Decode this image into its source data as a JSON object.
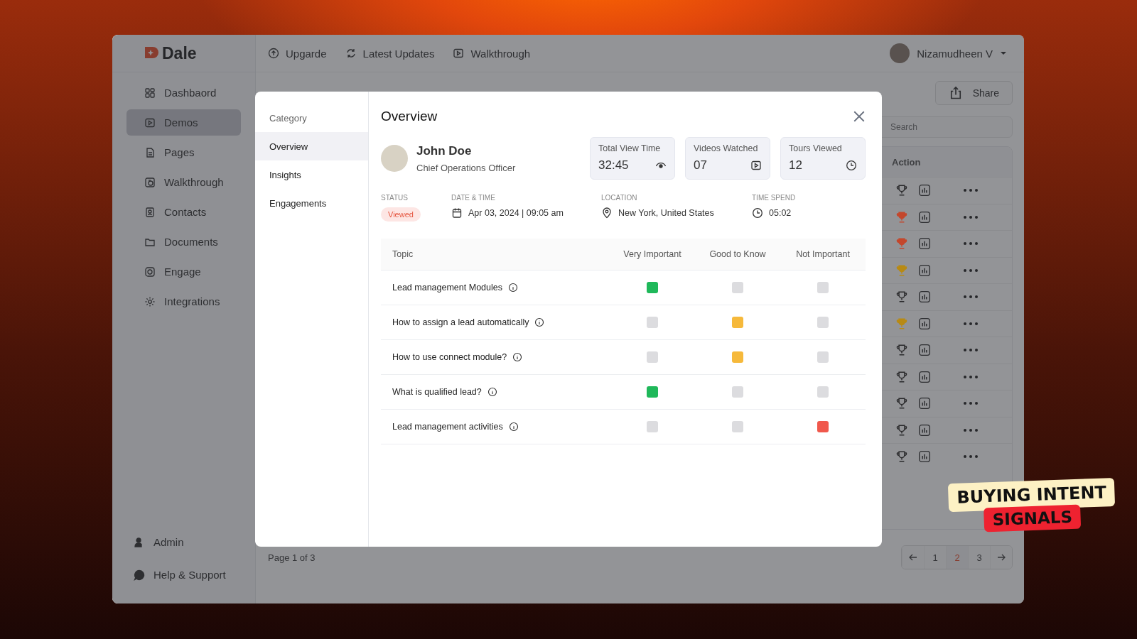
{
  "brand": "Dale",
  "topnav": [
    {
      "label": "Upgarde"
    },
    {
      "label": "Latest Updates"
    },
    {
      "label": "Walkthrough"
    }
  ],
  "user": {
    "name": "Nizamudheen V"
  },
  "sidebar": {
    "items": [
      {
        "label": "Dashbaord",
        "selected": false
      },
      {
        "label": "Demos",
        "selected": true
      },
      {
        "label": "Pages",
        "selected": false
      },
      {
        "label": "Walkthrough",
        "selected": false
      },
      {
        "label": "Contacts",
        "selected": false
      },
      {
        "label": "Documents",
        "selected": false
      },
      {
        "label": "Engage",
        "selected": false
      },
      {
        "label": "Integrations",
        "selected": false
      }
    ],
    "footer": [
      {
        "label": "Admin"
      },
      {
        "label": "Help & Support"
      }
    ]
  },
  "share_button": "Share",
  "search": {
    "placeholder": "Search"
  },
  "table": {
    "action_header": "Action",
    "rows": [
      {
        "trophy_filled": false
      },
      {
        "trophy_filled": true,
        "color": "#c4472c"
      },
      {
        "trophy_filled": true,
        "color": "#c4472c"
      },
      {
        "trophy_filled": true,
        "color": "#b88a14"
      },
      {
        "trophy_filled": false
      },
      {
        "trophy_filled": true,
        "color": "#b88a14"
      },
      {
        "trophy_filled": false
      },
      {
        "trophy_filled": false
      },
      {
        "trophy_filled": false
      },
      {
        "trophy_filled": false
      },
      {
        "trophy_filled": false
      }
    ]
  },
  "pagination": {
    "summary": "Page 1 of 3",
    "pages": [
      {
        "label": "1",
        "selected": false
      },
      {
        "label": "2",
        "selected": true
      },
      {
        "label": "3",
        "selected": false
      }
    ]
  },
  "modal": {
    "category_heading": "Category",
    "tabs": [
      {
        "label": "Overview",
        "selected": true
      },
      {
        "label": "Insights",
        "selected": false
      },
      {
        "label": "Engagements",
        "selected": false
      }
    ],
    "title": "Overview",
    "person": {
      "name": "John Doe",
      "role": "Chief Operations Officer"
    },
    "stats": [
      {
        "label": "Total View Time",
        "value": "32:45"
      },
      {
        "label": "Videos Watched",
        "value": "07"
      },
      {
        "label": "Tours Viewed",
        "value": "12"
      }
    ],
    "status": {
      "label": "STATUS",
      "value": "Viewed"
    },
    "details": [
      {
        "label": "DATE & TIME",
        "value": "Apr 03, 2024 | 09:05 am"
      },
      {
        "label": "LOCATION",
        "value": "New York, United States"
      },
      {
        "label": "TIME SPEND",
        "value": "05:02"
      }
    ],
    "topic_header": "Topic",
    "columns": [
      {
        "label": "Very Important",
        "color": "#1fb85a"
      },
      {
        "label": "Good to Know",
        "color": "#f6b93b"
      },
      {
        "label": "Not Important",
        "color": "#f0584c"
      }
    ],
    "topics": [
      {
        "label": "Lead management Modules",
        "choices": [
          {
            "selected": true
          },
          {
            "selected": false
          },
          {
            "selected": false
          }
        ]
      },
      {
        "label": "How to assign a lead automatically",
        "choices": [
          {
            "selected": false
          },
          {
            "selected": true
          },
          {
            "selected": false
          }
        ]
      },
      {
        "label": "How to use connect module?",
        "choices": [
          {
            "selected": false
          },
          {
            "selected": true
          },
          {
            "selected": false
          }
        ]
      },
      {
        "label": "What is qualified lead?",
        "choices": [
          {
            "selected": true
          },
          {
            "selected": false
          },
          {
            "selected": false
          }
        ]
      },
      {
        "label": "Lead management activities",
        "choices": [
          {
            "selected": false
          },
          {
            "selected": false
          },
          {
            "selected": true
          }
        ]
      }
    ]
  },
  "sticker": {
    "lines": [
      "BUYING INTENT",
      "SIGNALS"
    ]
  }
}
